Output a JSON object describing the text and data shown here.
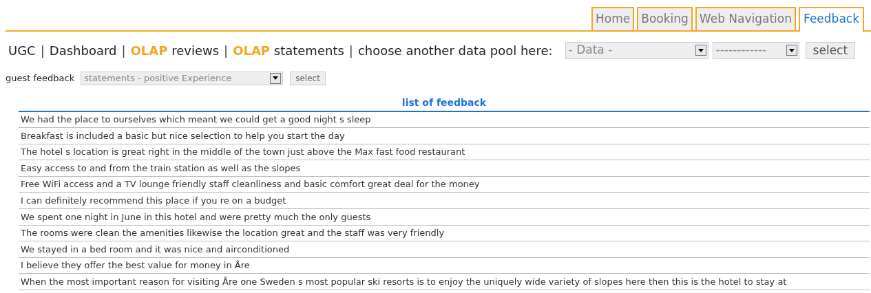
{
  "tabs": [
    {
      "label": "Home",
      "selected": false
    },
    {
      "label": "Booking",
      "selected": false
    },
    {
      "label": "Web Navigation",
      "selected": false
    },
    {
      "label": "Feedback",
      "selected": true
    }
  ],
  "nav": {
    "links": [
      {
        "label": "UGC",
        "separator": "|"
      },
      {
        "label": "Dashboard",
        "separator": "|"
      },
      {
        "label": "**OLAP** reviews",
        "separator": "|"
      },
      {
        "label": "**OLAP** statements",
        "separator": "|"
      }
    ],
    "prompt": "choose another data pool here:",
    "pool_select": {
      "value": "- Data -"
    },
    "sub_select": {
      "value": "------------"
    },
    "button": "select"
  },
  "filter": {
    "label": "guest feedback",
    "select": {
      "value": "statements - positive Experience"
    },
    "button": "select"
  },
  "table": {
    "title": "list of feedback",
    "rows": [
      "We had the place to ourselves which meant we could get a good night s sleep",
      "Breakfast is included a basic but nice selection to help you start the day",
      "The hotel s location is great right in the middle of the town just above the Max fast food restaurant",
      "Easy access to and from the train station as well as the slopes",
      "Free WiFi access and a TV lounge friendly staff cleanliness and basic comfort great deal for the money",
      "I can definitely recommend this place if you re on a budget",
      "We spent one night in June in this hotel and were pretty much the only guests",
      "The rooms were clean the amenities likewise the location great and the staff was very friendly",
      "We stayed in a bed room and it was nice and airconditioned",
      "I believe they offer the best value for money in Åre",
      "When the most important reason for visiting Åre one Sweden s most popular ski resorts is to enjoy the uniquely wide variety of slopes here then this is the hotel to stay at"
    ]
  }
}
